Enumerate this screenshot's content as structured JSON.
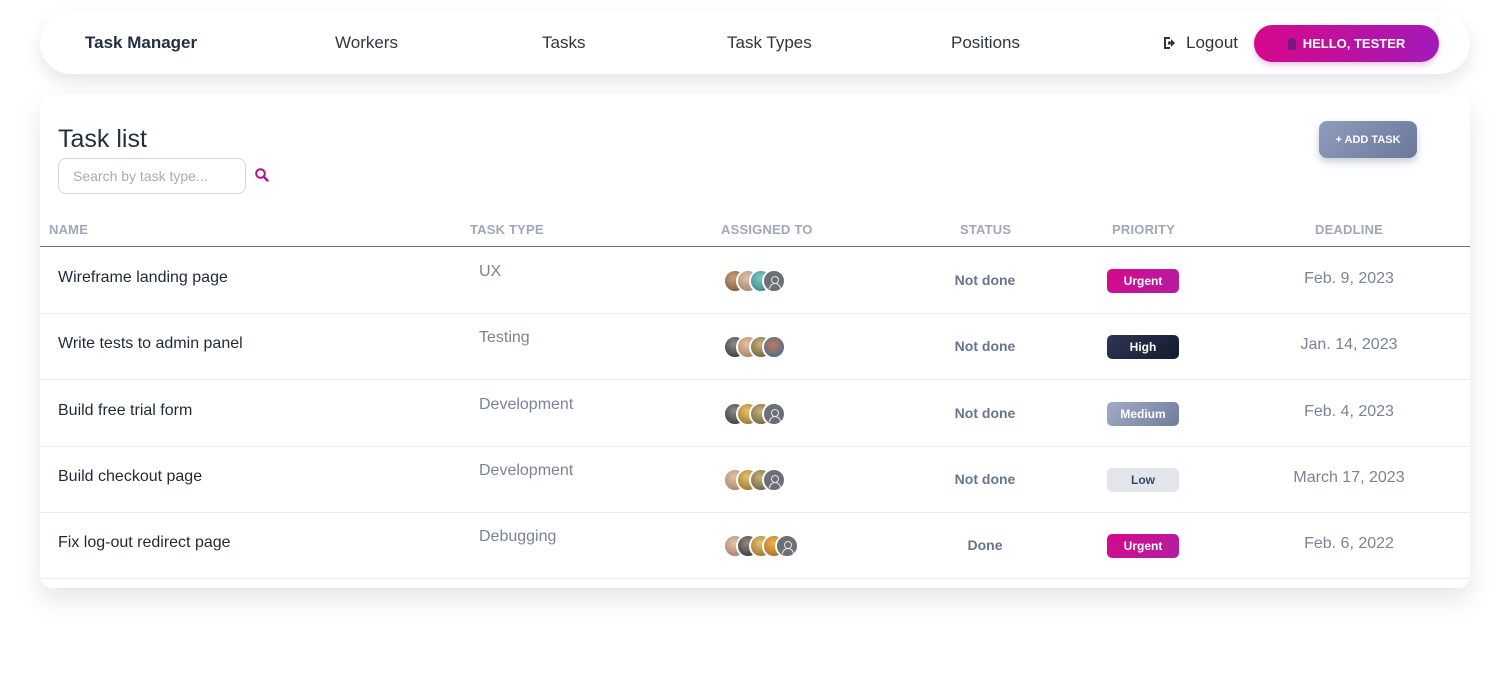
{
  "nav": {
    "brand": "Task Manager",
    "links": [
      "Workers",
      "Tasks",
      "Task Types",
      "Positions"
    ],
    "logout_label": "Logout",
    "hello_label": "HELLO, TESTER"
  },
  "card": {
    "title": "Task list",
    "search_placeholder": "Search by task type...",
    "add_button_label": "+ ADD TASK"
  },
  "table": {
    "columns": [
      "NAME",
      "TASK TYPE",
      "ASSIGNED TO",
      "STATUS",
      "PRIORITY",
      "DEADLINE"
    ],
    "rows": [
      {
        "name": "Wireframe landing page",
        "type": "UX",
        "status": "Not done",
        "priority": "Urgent",
        "deadline": "Feb. 9, 2023",
        "avatars": [
          "photo-brown",
          "photo-tan",
          "photo-teal",
          "default"
        ]
      },
      {
        "name": "Write tests to admin panel",
        "type": "Testing",
        "status": "Not done",
        "priority": "High",
        "deadline": "Jan. 14, 2023",
        "avatars": [
          "photo-dark",
          "photo-tan",
          "photo-olive",
          "photo-blue"
        ]
      },
      {
        "name": "Build free trial form",
        "type": "Development",
        "status": "Not done",
        "priority": "Medium",
        "deadline": "Feb. 4, 2023",
        "avatars": [
          "photo-dark",
          "photo-gold",
          "photo-olive",
          "default"
        ]
      },
      {
        "name": "Build checkout page",
        "type": "Development",
        "status": "Not done",
        "priority": "Low",
        "deadline": "March 17, 2023",
        "avatars": [
          "photo-tan",
          "photo-gold",
          "photo-olive",
          "default"
        ]
      },
      {
        "name": "Fix log-out redirect page",
        "type": "Debugging",
        "status": "Done",
        "priority": "Urgent",
        "deadline": "Feb. 6, 2022",
        "avatars": [
          "photo-tan",
          "photo-dark",
          "photo-gold",
          "photo-orange",
          "default"
        ]
      }
    ]
  },
  "colors": {
    "urgent": "#c7158f",
    "high": "#232a45",
    "medium": "#7d89a8",
    "low": "#e4e7ec",
    "accent": "#d6088a"
  }
}
